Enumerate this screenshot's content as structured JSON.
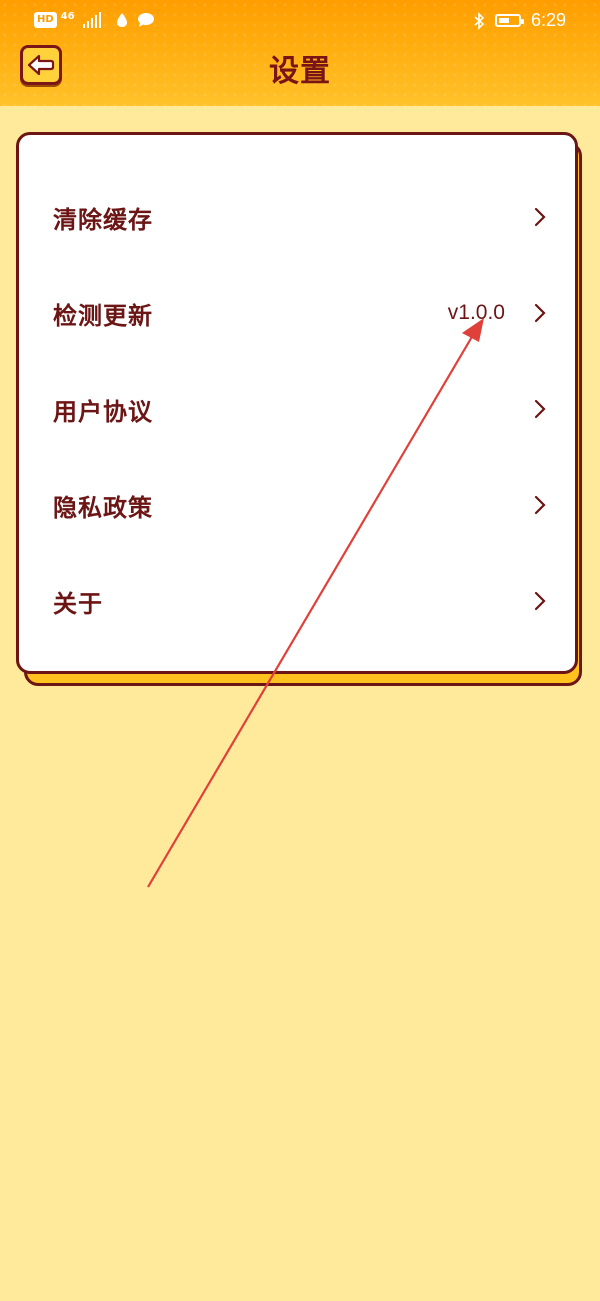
{
  "status_bar": {
    "hd": "HD",
    "network": "46",
    "time": "6:29"
  },
  "header": {
    "title": "设置",
    "back_icon": "back-arrow-icon"
  },
  "settings": {
    "items": [
      {
        "label": "清除缓存",
        "value": ""
      },
      {
        "label": "检测更新",
        "value": "v1.0.0"
      },
      {
        "label": "用户协议",
        "value": ""
      },
      {
        "label": "隐私政策",
        "value": ""
      },
      {
        "label": "关于",
        "value": ""
      }
    ]
  },
  "colors": {
    "header_top": "#FF9D00",
    "header_bottom": "#FFC22A",
    "background": "#FFE99A",
    "text_dark_red": "#6C1515",
    "card_shadow": "#FFC21F",
    "annotation_arrow": "#E0403A"
  }
}
